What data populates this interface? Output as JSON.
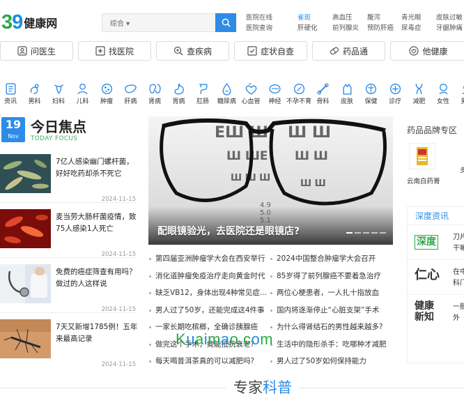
{
  "header": {
    "logo_number": "39",
    "logo_text": "健康网",
    "search_category": "综合",
    "links": [
      {
        "top": "医院在线",
        "bottom": "医院查询"
      },
      {
        "top": "雀斑",
        "bottom": "肝硬化"
      },
      {
        "top": "高血压",
        "bottom": "前列腺炎"
      },
      {
        "top": "腹泻",
        "bottom": "预防肝癌"
      },
      {
        "top": "青光眼",
        "bottom": "尿毒症"
      },
      {
        "top": "皮肤过敏",
        "bottom": "牙龈肿痛"
      }
    ]
  },
  "nav": [
    {
      "label": "问医生",
      "icon": "person-icon"
    },
    {
      "label": "找医院",
      "icon": "hospital-icon"
    },
    {
      "label": "查疾病",
      "icon": "search-plus-icon"
    },
    {
      "label": "症状自查",
      "icon": "checklist-icon"
    },
    {
      "label": "药品通",
      "icon": "pill-icon"
    },
    {
      "label": "他健康",
      "icon": "heart-icon"
    }
  ],
  "categories": [
    "资讯",
    "男科",
    "妇科",
    "儿科",
    "肿瘤",
    "肝病",
    "肾病",
    "胃病",
    "肛肠",
    "糖尿病",
    "心血管",
    "神经",
    "不孕不育",
    "骨科",
    "皮肤",
    "保健",
    "诊疗",
    "减肥",
    "女性",
    "男性"
  ],
  "focus": {
    "day": "19",
    "month": "Nov",
    "title": "今日焦点",
    "subtitle": "TODAY FOCUS",
    "items": [
      {
        "title": "7亿人感染幽门螺杆菌，好好吃药却杀不死它",
        "date": "2024-11-15"
      },
      {
        "title": "麦当劳大肠杆菌疫情，致75人感染1人死亡",
        "date": "2024-11-15"
      },
      {
        "title": "免费的癌症筛查有用吗？做过的人这样说",
        "date": "2024-11-15"
      },
      {
        "title": "7天又新增1785例！五年来最高记录",
        "date": "2024-11-15"
      }
    ]
  },
  "banner": {
    "caption": "配眼镜验光，去医院还是眼镜店?",
    "chart_letters": [
      "4.9",
      "5.0",
      "5.1"
    ]
  },
  "headlines_left": [
    "第四届亚洲肿瘤学大会在西安举行",
    "消化道肿瘤免疫治疗走向黄金时代",
    "缺乏VB12，身体出现4种常见症...",
    "男人过了50岁，还能完成这4件事",
    "一家长期吃槟榔，全确诊胰腺癌",
    "做完这个手术，竟能抵抗衰老?",
    "每天喝普洱茶真的可以减肥吗?"
  ],
  "headlines_right": [
    "2024中国整合肿瘤学大会召开",
    "85岁得了前列腺癌不要着急治疗",
    "两位心梗患者，一人扎十指放血",
    "国内将逐渐停止“心脏支架”手术",
    "为什么得肾结石的男性越来越多?",
    "生活中的隐形杀手：吃哪种才减肥",
    "男人过了50岁如何保持能力"
  ],
  "right_col": {
    "brand_title": "药品品牌专区",
    "brand_name": "云南白药膏",
    "brand_extra": "多",
    "deep_title": "深度资讯",
    "deep_items": [
      {
        "logo": "深度",
        "text": "刀片干嘛"
      },
      {
        "logo": "仁心",
        "text": "在中科门"
      },
      {
        "logo": "健康新知",
        "text": "一肠外"
      }
    ]
  },
  "watermark": [
    "K",
    "u",
    "a",
    "i",
    "m",
    "a",
    "o",
    ".",
    "c",
    "o",
    "m"
  ],
  "expert": {
    "a": "专家",
    "b": "科普"
  },
  "colors": {
    "brand_blue": "#2d8ce7",
    "brand_green": "#2aa845"
  }
}
